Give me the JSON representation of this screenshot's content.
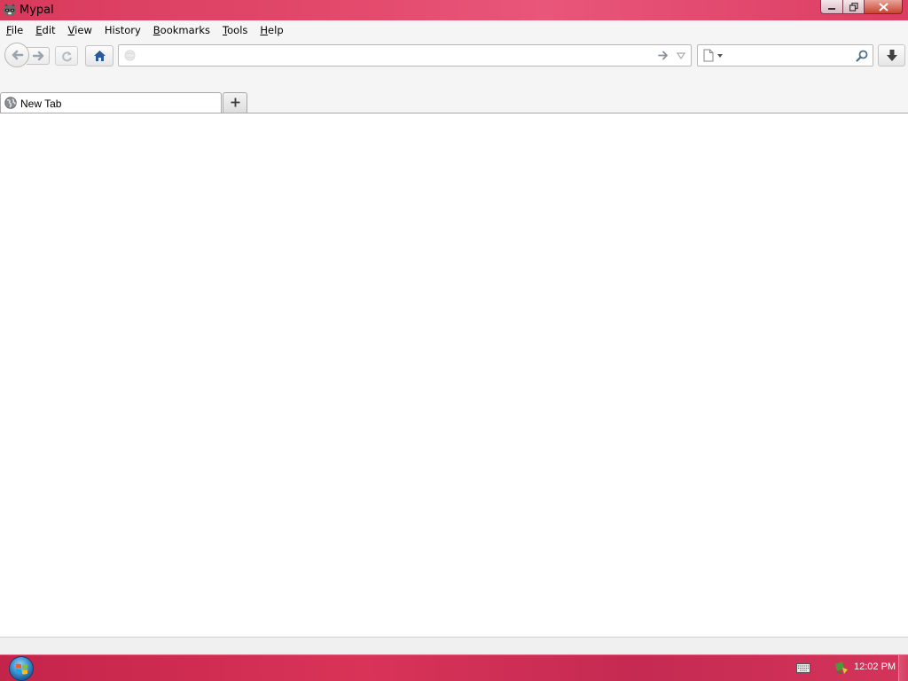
{
  "window": {
    "title": "Mypal"
  },
  "menu": {
    "items": [
      {
        "label": "File",
        "accesskey": "F",
        "rest": "ile"
      },
      {
        "label": "Edit",
        "accesskey": "E",
        "rest": "dit"
      },
      {
        "label": "View",
        "accesskey": "V",
        "rest": "iew"
      },
      {
        "label": "History",
        "accesskey": "H",
        "pre": "",
        "rest": "istory"
      },
      {
        "label": "Bookmarks",
        "accesskey": "B",
        "rest": "ookmarks"
      },
      {
        "label": "Tools",
        "accesskey": "T",
        "rest": "ools"
      },
      {
        "label": "Help",
        "accesskey": "H",
        "rest": "elp"
      }
    ]
  },
  "navbar": {
    "url_value": "",
    "url_placeholder": "",
    "search_value": "",
    "search_placeholder": ""
  },
  "tabs": [
    {
      "label": "New Tab",
      "active": true
    }
  ],
  "taskbar": {
    "clock": "12:02 PM"
  },
  "colors": {
    "titlebar": "#e2486a",
    "taskbar": "#d93358",
    "home_icon": "#2a5a9a"
  },
  "icons": {
    "app": "mypal-raccoon-icon",
    "back": "back-arrow-icon",
    "forward": "forward-arrow-icon",
    "reload": "reload-icon",
    "home": "home-icon",
    "go": "go-arrow-icon",
    "dropdown": "dropdown-arrow-icon",
    "search": "magnifier-icon",
    "download": "download-arrow-icon",
    "new_tab": "plus-icon"
  }
}
